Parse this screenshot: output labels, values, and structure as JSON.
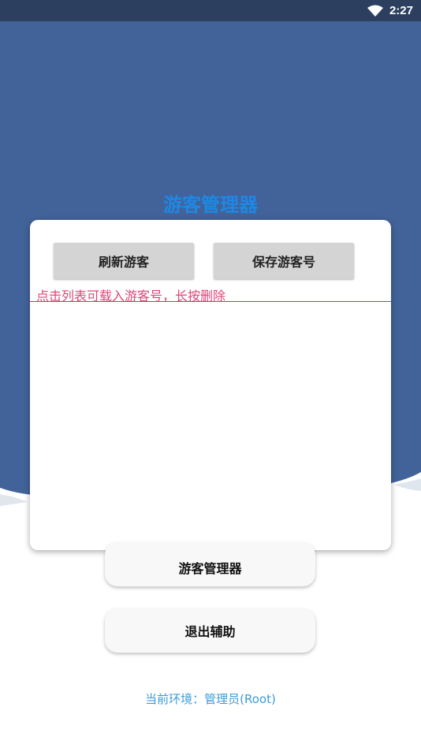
{
  "status_bar": {
    "time": "2:27"
  },
  "hero": {
    "title": "游客管理器",
    "background_color": "#42639a"
  },
  "dialog": {
    "refresh_label": "刷新游客",
    "save_label": "保存游客号",
    "hint": "点击列表可载入游客号，长按删除"
  },
  "menu": {
    "guest_manager_label": "游客管理器",
    "exit_label": "退出辅助"
  },
  "footer": {
    "environment": "当前环境：管理员(Root)"
  }
}
